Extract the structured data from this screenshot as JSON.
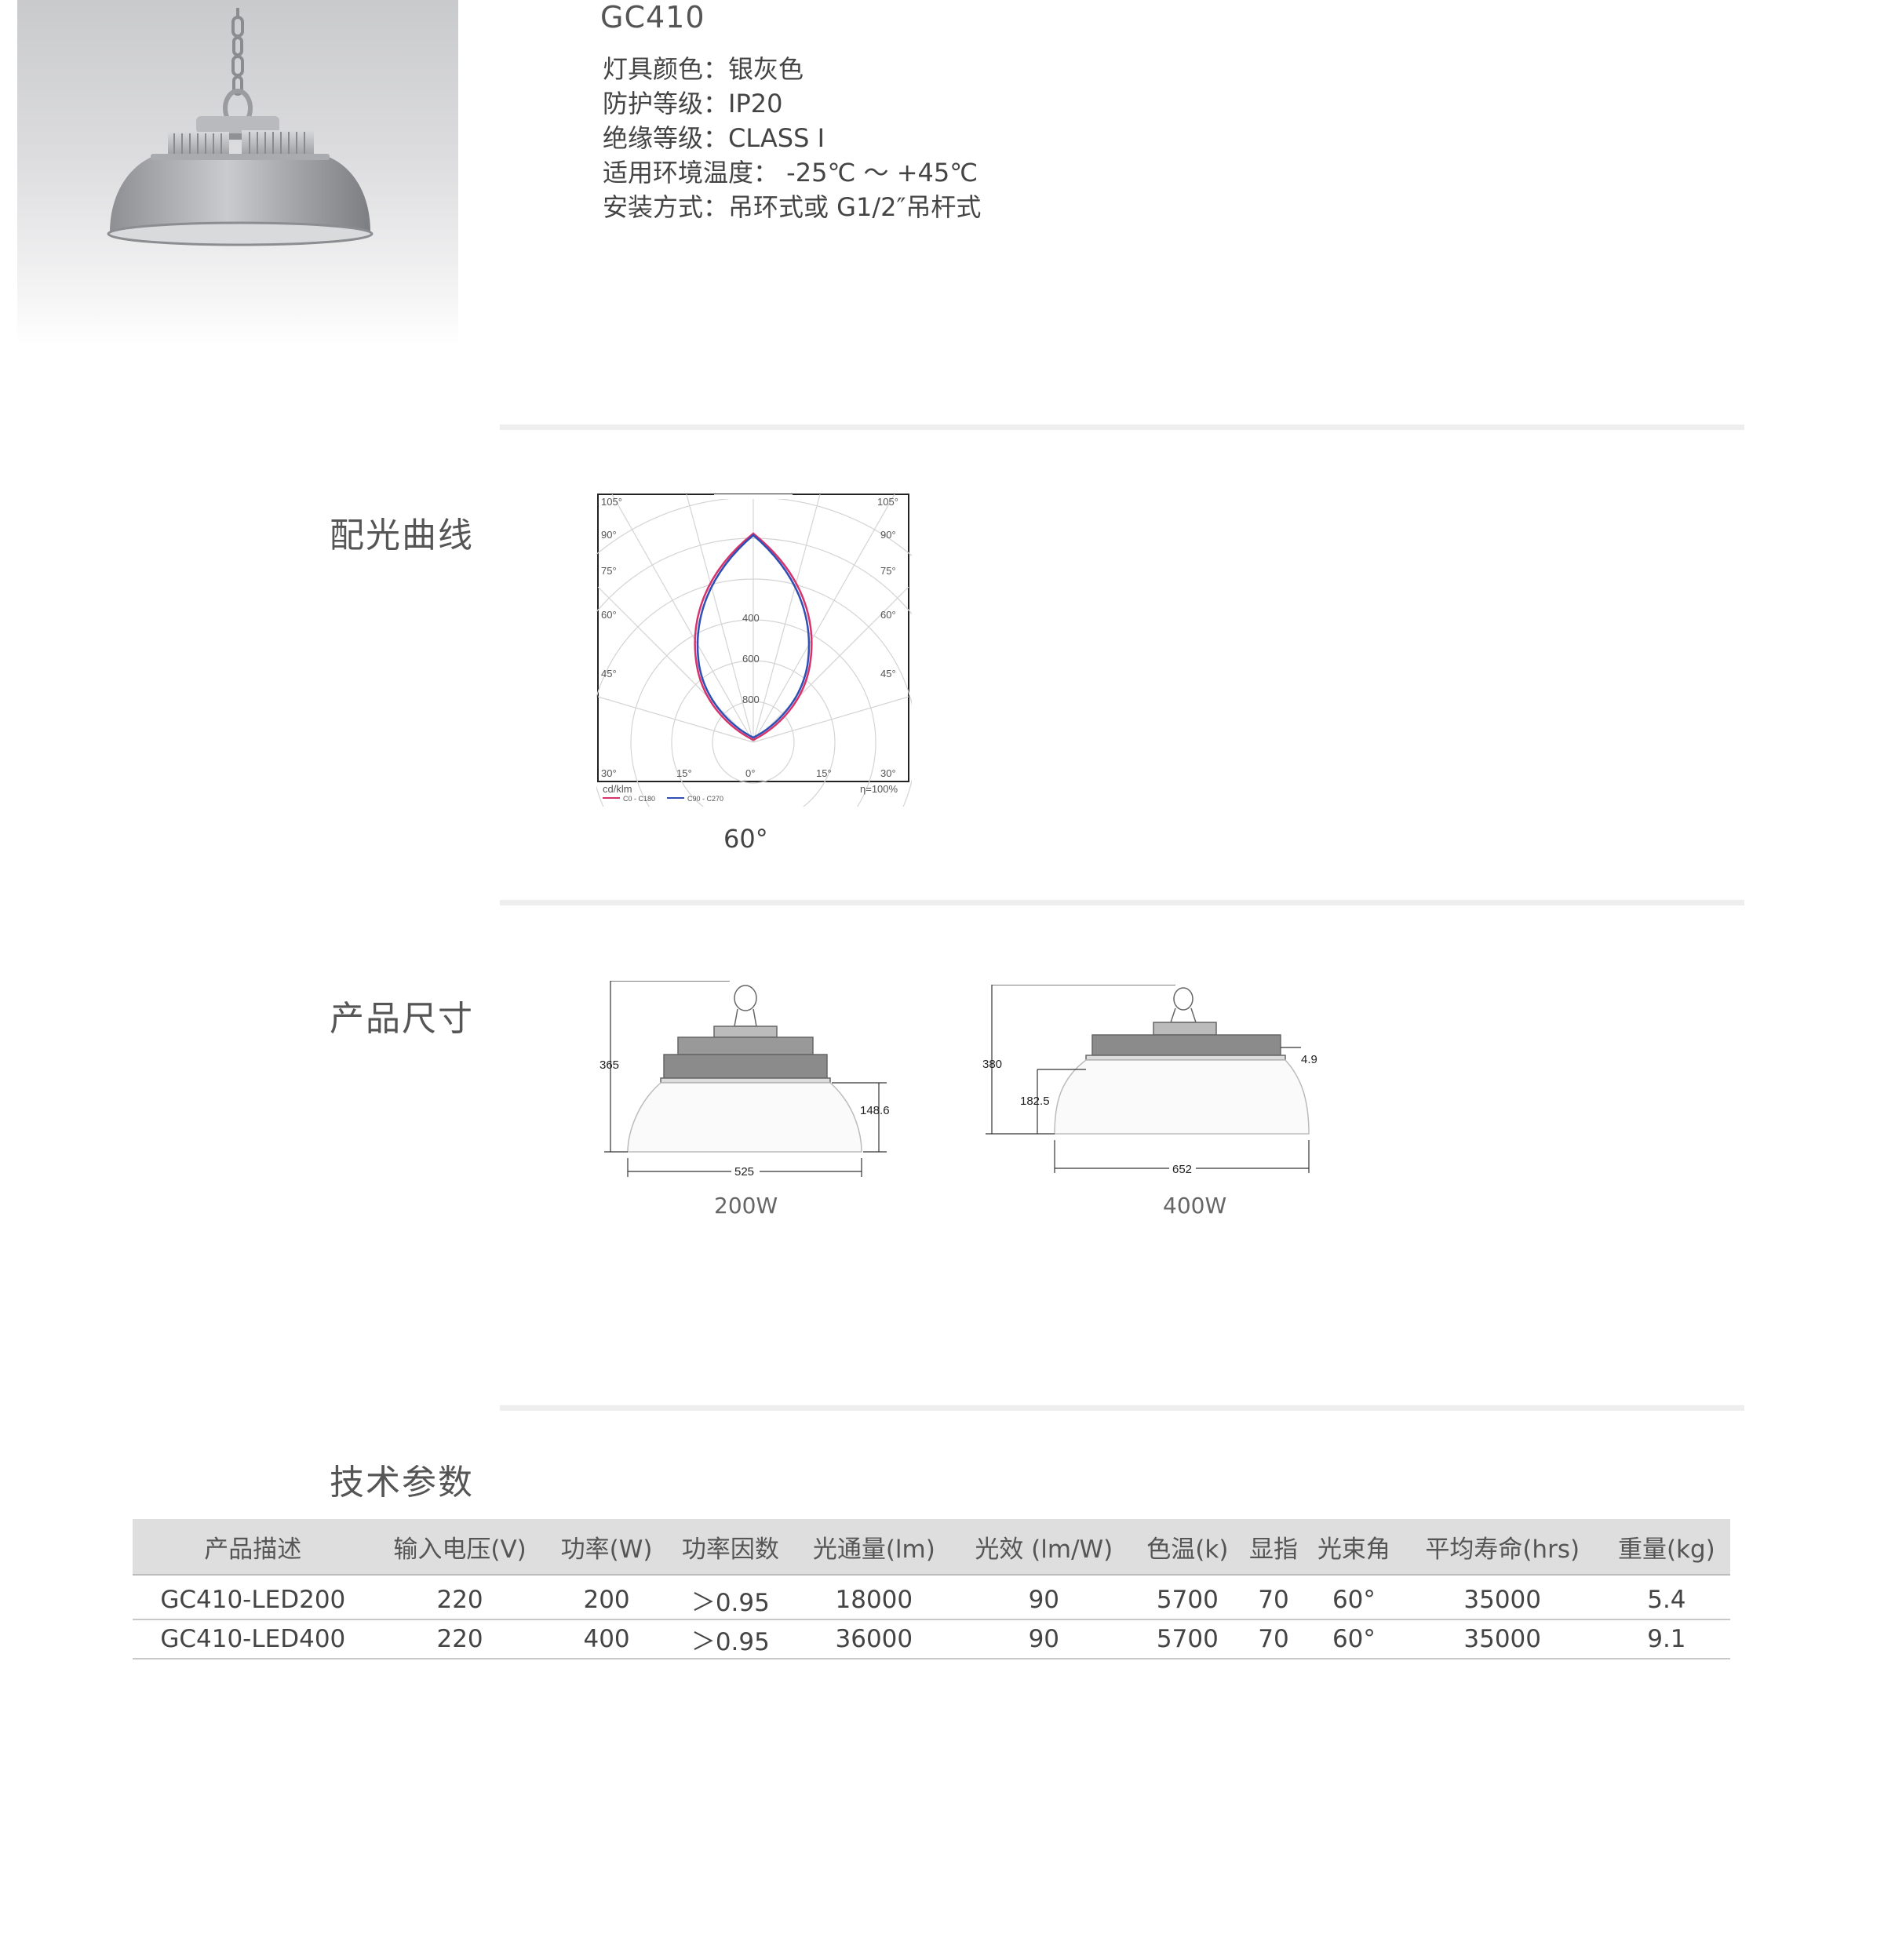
{
  "product": {
    "model": "GC410",
    "specs": [
      "灯具颜色：银灰色",
      "防护等级：IP20",
      "绝缘等级：CLASS Ⅰ",
      "适用环境温度： -25℃ ～ +45℃",
      "安装方式：吊环式或 G1/2″吊杆式"
    ]
  },
  "sections": {
    "light_curve": "配光曲线",
    "dimensions": "产品尺寸",
    "tech_params": "技术参数"
  },
  "polar_chart": {
    "unit": "cd/klm",
    "efficiency": "η=100%",
    "legend": [
      "C0 - C180",
      "C90 - C270"
    ],
    "legend_colors": [
      "#d6336c",
      "#2f4fb5"
    ],
    "radial_labels": [
      "400",
      "600",
      "800"
    ],
    "angle_labels_left": [
      "105°",
      "90°",
      "75°",
      "60°",
      "45°",
      "30°"
    ],
    "angle_labels_right": [
      "105°",
      "90°",
      "75°",
      "60°",
      "45°",
      "30°"
    ],
    "bottom_labels": [
      "15°",
      "0°",
      "15°"
    ],
    "beam_angle": "60°"
  },
  "drawings": {
    "w200": {
      "caption": "200W",
      "height": "365",
      "shade_height": "148.6",
      "width": "525"
    },
    "w400": {
      "caption": "400W",
      "height": "380",
      "shade_height": "182.5",
      "top_height": "4.9",
      "width": "652"
    }
  },
  "table": {
    "headers": [
      "产品描述",
      "输入电压(V)",
      "功率(W)",
      "功率因数",
      "光通量(lm)",
      "光效 (lm/W)",
      "色温(k)",
      "显指",
      "光束角",
      "平均寿命(hrs)",
      "重量(kg)"
    ],
    "rows": [
      [
        "GC410-LED200",
        "220",
        "200",
        "＞0.95",
        "18000",
        "90",
        "5700",
        "70",
        "60°",
        "35000",
        "5.4"
      ],
      [
        "GC410-LED400",
        "220",
        "400",
        "＞0.95",
        "36000",
        "90",
        "5700",
        "70",
        "60°",
        "35000",
        "9.1"
      ]
    ]
  }
}
